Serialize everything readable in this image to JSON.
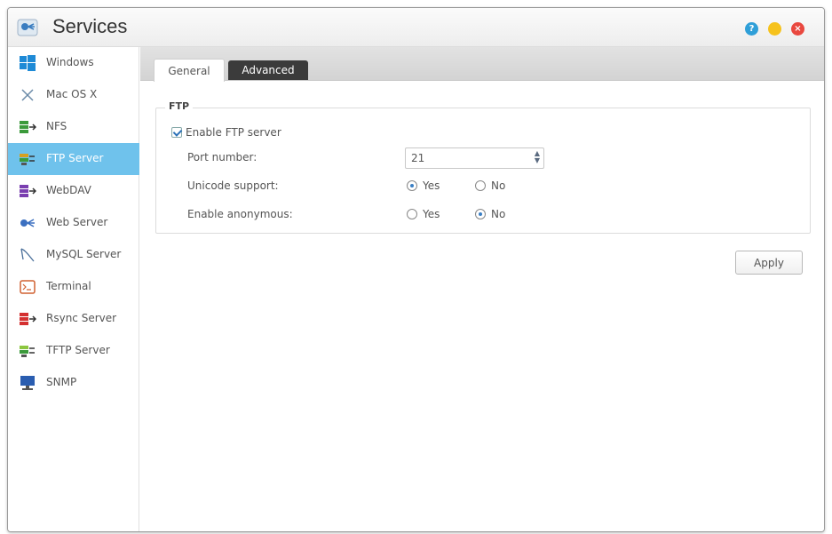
{
  "window": {
    "title": "Services"
  },
  "sidebar": {
    "items": [
      {
        "label": "Windows",
        "icon": "windows-icon"
      },
      {
        "label": "Mac OS X",
        "icon": "mac-os-x-icon"
      },
      {
        "label": "NFS",
        "icon": "nfs-icon"
      },
      {
        "label": "FTP Server",
        "icon": "ftp-server-icon",
        "active": true
      },
      {
        "label": "WebDAV",
        "icon": "webdav-icon"
      },
      {
        "label": "Web Server",
        "icon": "web-server-icon"
      },
      {
        "label": "MySQL Server",
        "icon": "mysql-server-icon"
      },
      {
        "label": "Terminal",
        "icon": "terminal-icon"
      },
      {
        "label": "Rsync Server",
        "icon": "rsync-server-icon"
      },
      {
        "label": "TFTP Server",
        "icon": "tftp-server-icon"
      },
      {
        "label": "SNMP",
        "icon": "snmp-icon"
      }
    ]
  },
  "tabs": {
    "general": "General",
    "advanced": "Advanced",
    "active": "General"
  },
  "ftp": {
    "legend": "FTP",
    "enable_label": "Enable FTP server",
    "enable_checked": true,
    "port_label": "Port number:",
    "port_value": "21",
    "unicode_label": "Unicode support:",
    "unicode_value": "Yes",
    "anonymous_label": "Enable anonymous:",
    "anonymous_value": "No",
    "yes_label": "Yes",
    "no_label": "No"
  },
  "actions": {
    "apply": "Apply"
  },
  "colors": {
    "active_item": "#6fc2ec",
    "advanced_tab": "#3b3b3b",
    "help": "#2f9fd8",
    "minimize": "#f6c21c",
    "close": "#e9483f"
  }
}
